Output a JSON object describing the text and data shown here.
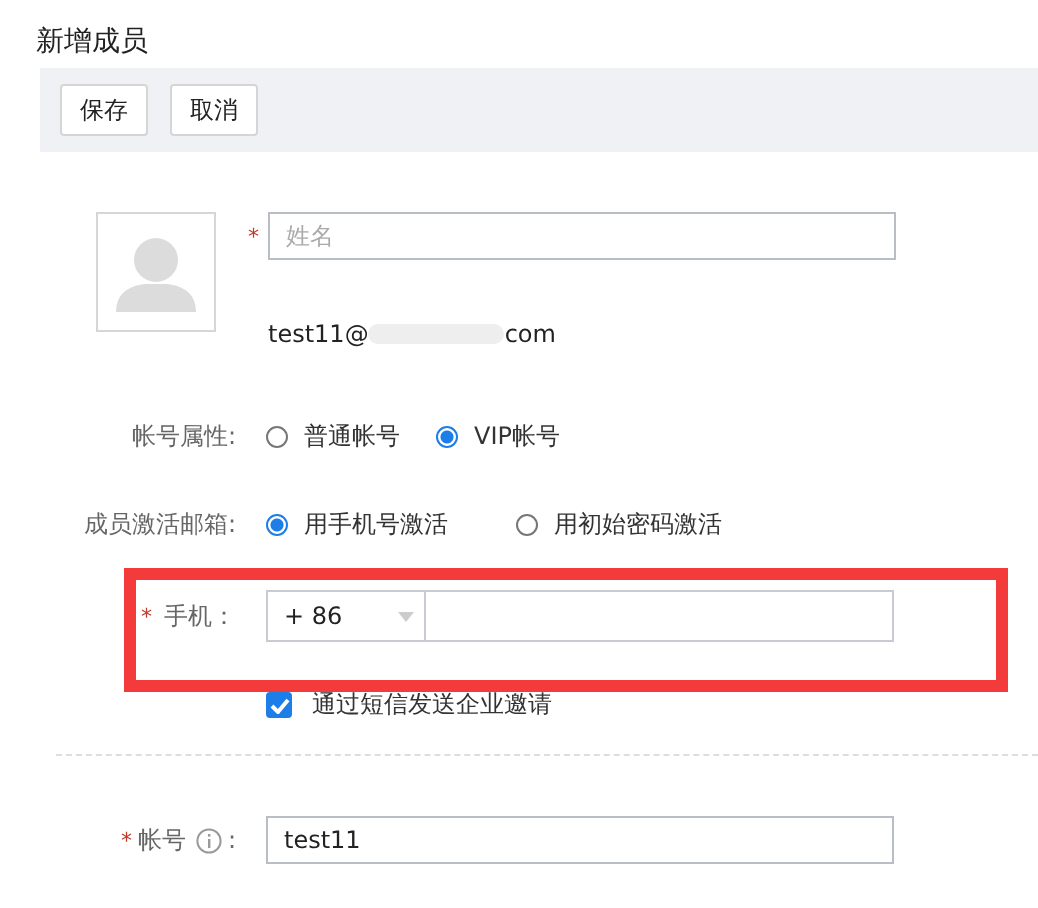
{
  "title": "新增成员",
  "toolbar": [
    "保存",
    "取消"
  ],
  "name_field": {
    "placeholder": "姓名",
    "required_mark": "*"
  },
  "email": {
    "prefix": "test11@",
    "suffix": "com"
  },
  "account_type": {
    "label": "帐号属性:",
    "options": [
      {
        "label": "普通帐号",
        "selected": false
      },
      {
        "label": "VIP帐号",
        "selected": true
      }
    ]
  },
  "activation": {
    "label": "成员激活邮箱:",
    "options": [
      {
        "label": "用手机号激活",
        "selected": true
      },
      {
        "label": "用初始密码激活",
        "selected": false
      }
    ]
  },
  "phone": {
    "label": "手机：",
    "required_mark": "*",
    "country_code": "+ 86",
    "highlighted": true
  },
  "sms_invite": {
    "label": "通过短信发送企业邀请",
    "checked": true
  },
  "account": {
    "label": "帐号",
    "colon": ":",
    "required_mark": "*",
    "value": "test11"
  }
}
